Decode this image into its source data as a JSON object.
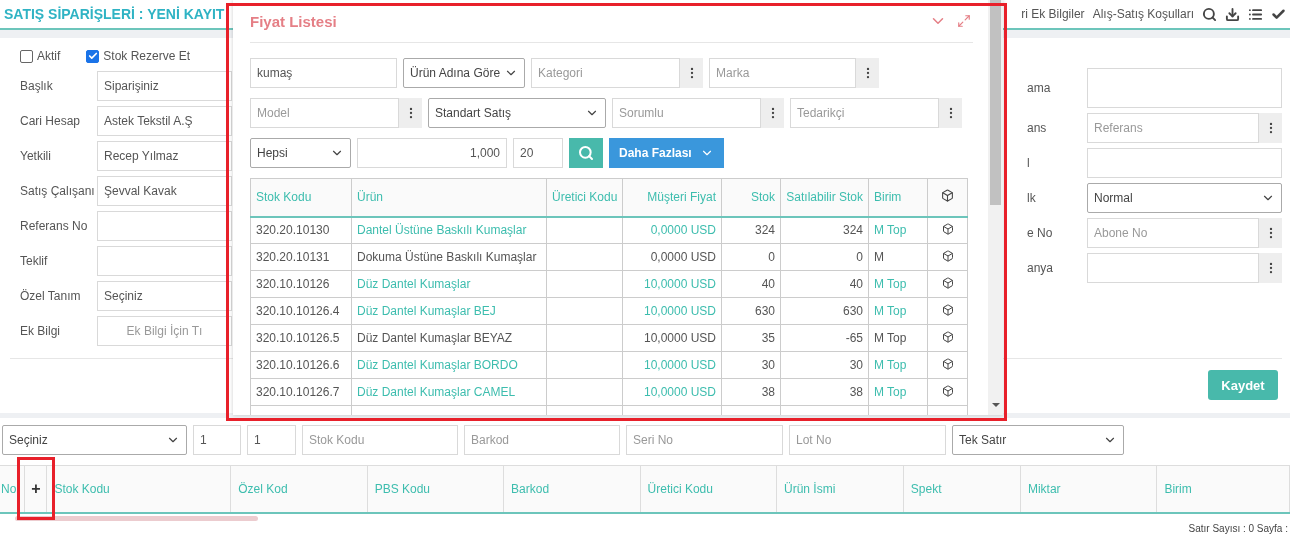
{
  "header": {
    "title": "SATIŞ SİPARİŞLERİ : YENİ KAYIT",
    "links": [
      "ri Ek Bilgiler",
      "Alış-Satış Koşulları"
    ]
  },
  "form": {
    "options": [
      {
        "label": "Aktif",
        "checked": false
      },
      {
        "label": "Stok Rezerve Et",
        "checked": true
      }
    ],
    "left_fields": [
      {
        "label": "Başlık",
        "value": "Siparişiniz"
      },
      {
        "label": "Cari Hesap",
        "value": "Astek Tekstil A.Ş"
      },
      {
        "label": "Yetkili",
        "value": "Recep Yılmaz"
      },
      {
        "label": "Satış Çalışanı",
        "value": "Şevval Kavak"
      },
      {
        "label": "Referans No"
      },
      {
        "label": "Teklif"
      },
      {
        "label": "Özel Tanım",
        "value": "Seçiniz"
      },
      {
        "label": "Ek Bilgi",
        "placeholder": "Ek Bilgi İçin Tı"
      }
    ],
    "right_fields": [
      {
        "label": "ama",
        "kind": "textarea"
      },
      {
        "label": "ans",
        "kind": "lookup",
        "placeholder": "Referans"
      },
      {
        "label": "l",
        "kind": "text"
      },
      {
        "label": "lk",
        "kind": "select",
        "value": "Normal"
      },
      {
        "label": "e No",
        "kind": "lookup",
        "placeholder": "Abone No"
      },
      {
        "label": "anya",
        "kind": "lookup"
      }
    ],
    "save_button": "Kaydet"
  },
  "modal": {
    "title": "Fiyat Listesi",
    "filter_rows": [
      [
        {
          "kind": "text",
          "value": "kumaş"
        },
        {
          "kind": "select",
          "value": "Ürün Adına Göre"
        },
        {
          "kind": "lookup",
          "placeholder": "Kategori"
        },
        {
          "kind": "lookup",
          "placeholder": "Marka"
        }
      ],
      [
        {
          "kind": "lookup",
          "placeholder": "Model"
        },
        {
          "kind": "select",
          "value": "Standart Satış"
        },
        {
          "kind": "lookup",
          "placeholder": "Sorumlu"
        },
        {
          "kind": "lookup",
          "placeholder": "Tedarikçi"
        }
      ],
      [
        {
          "kind": "select",
          "value": "Hepsi"
        },
        {
          "kind": "number",
          "value": "1,000"
        },
        {
          "kind": "text",
          "value": "20"
        }
      ]
    ],
    "more_button": "Daha Fazlası",
    "table": {
      "columns": [
        "Stok Kodu",
        "Ürün",
        "Üretici Kodu",
        "Müşteri Fiyat",
        "Stok",
        "Satılabilir Stok",
        "Birim"
      ],
      "rows": [
        {
          "stock_code": "320.20.10130",
          "product": "Dantel Üstüne Baskılı Kumaşlar",
          "price": "0,0000 USD",
          "stock": "324",
          "available_stock": "324",
          "unit": "M Top",
          "linked": true
        },
        {
          "stock_code": "320.20.10131",
          "product": "Dokuma Üstüne Baskılı Kumaşlar",
          "price": "0,0000 USD",
          "stock": "0",
          "available_stock": "0",
          "unit": "M",
          "linked": false
        },
        {
          "stock_code": "320.10.10126",
          "product": "Düz Dantel Kumaşlar",
          "price": "10,0000 USD",
          "stock": "40",
          "available_stock": "40",
          "unit": "M Top",
          "linked": true
        },
        {
          "stock_code": "320.10.10126.4",
          "product": "Düz Dantel Kumaşlar BEJ",
          "price": "10,0000 USD",
          "stock": "630",
          "available_stock": "630",
          "unit": "M Top",
          "linked": true
        },
        {
          "stock_code": "320.10.10126.5",
          "product": "Düz Dantel Kumaşlar BEYAZ",
          "price": "10,0000 USD",
          "stock": "35",
          "available_stock": "-65",
          "unit": "M Top",
          "linked": false
        },
        {
          "stock_code": "320.10.10126.6",
          "product": "Düz Dantel Kumaşlar BORDO",
          "price": "10,0000 USD",
          "stock": "30",
          "available_stock": "30",
          "unit": "M Top",
          "linked": true
        },
        {
          "stock_code": "320.10.10126.7",
          "product": "Düz Dantel Kumaşlar CAMEL",
          "price": "10,0000 USD",
          "stock": "38",
          "available_stock": "38",
          "unit": "M Top",
          "linked": true
        }
      ]
    }
  },
  "line_entry": [
    {
      "kind": "select",
      "value": "Seçiniz"
    },
    {
      "kind": "text",
      "value": "1"
    },
    {
      "kind": "text",
      "value": "1"
    },
    {
      "kind": "text",
      "placeholder": "Stok Kodu"
    },
    {
      "kind": "text",
      "placeholder": "Barkod"
    },
    {
      "kind": "text",
      "placeholder": "Seri No"
    },
    {
      "kind": "text",
      "placeholder": "Lot No"
    },
    {
      "kind": "select",
      "value": "Tek Satır"
    }
  ],
  "lines_table": {
    "columns": [
      "No",
      "Stok Kodu",
      "Özel Kod",
      "PBS Kodu",
      "Barkod",
      "Üretici Kodu",
      "Ürün İsmi",
      "Spekt",
      "Miktar",
      "Birim"
    ],
    "add_button": "+"
  },
  "status_bar": "Satır Sayısı : 0 Sayfa :"
}
